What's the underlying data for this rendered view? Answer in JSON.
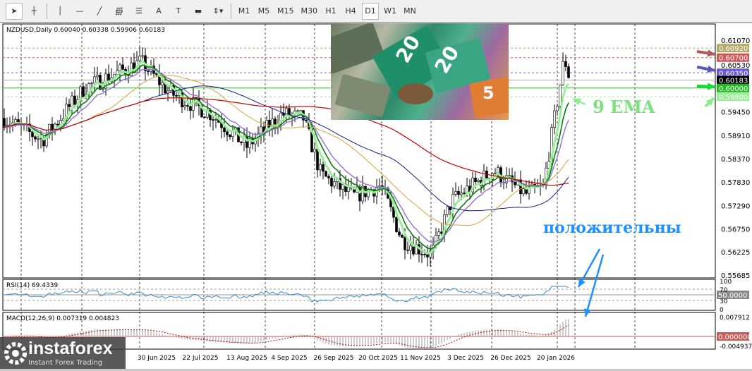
{
  "toolbar": {
    "tools": [
      "cursor",
      "crosshair",
      "vertical-line",
      "horizontal-line",
      "trendline",
      "fibonacci",
      "fibo-channel",
      "text",
      "text-label",
      "rectangle",
      "arrows"
    ],
    "text_label": "A",
    "timeframes": [
      "M1",
      "M5",
      "M15",
      "M30",
      "H1",
      "H4",
      "D1",
      "W1",
      "MN"
    ],
    "selected": "D1"
  },
  "chart": {
    "symbol_info": "NZDUSD,Daily  0.60040 0.60338 0.59906 0.60183",
    "price_ticks": [
      "0.61070",
      "0.60530",
      "0.59450",
      "0.58910",
      "0.58370",
      "0.57830",
      "0.57290",
      "0.56750",
      "0.56225",
      "0.55685"
    ],
    "price_ticks_values": [
      0.6107,
      0.6053,
      0.5945,
      0.5891,
      0.5837,
      0.5783,
      0.5729,
      0.5675,
      0.56225,
      0.55685
    ],
    "levels": [
      {
        "label": "0.60920",
        "value": 0.6092,
        "color": "#b5a96a"
      },
      {
        "label": "0.60700",
        "value": 0.607,
        "color": "#c85a5a"
      },
      {
        "label": "0.60350",
        "value": 0.6035,
        "color": "#6a5acd"
      },
      {
        "label": "0.60183",
        "value": 0.60183,
        "color": "#000000"
      },
      {
        "label": "0.60000",
        "value": 0.6,
        "color": "#22bb22"
      },
      {
        "label": "0.59800",
        "value": 0.598,
        "color": "#99ee99"
      }
    ],
    "dates": [
      "30 Jun 2025",
      "22 Jul 2025",
      "13 Aug 2025",
      "4 Sep 2025",
      "26 Sep 2025",
      "20 Oct 2025",
      "11 Nov 2025",
      "3 Dec 2025",
      "26 Dec 2025",
      "20 Jan 2026"
    ]
  },
  "rsi": {
    "label": "RSI(14) 69.4339",
    "ticks": [
      "100",
      "70",
      "30",
      "0"
    ],
    "level_label": "50.0000"
  },
  "macd": {
    "label": "MACD(12,26,9) 0.007319 0.004823",
    "ticks": [
      "0.007912",
      "-0.004937"
    ],
    "zero_label": "0.000000"
  },
  "annotations": {
    "ema": "9 EMA",
    "positive": "положительны"
  },
  "logo": {
    "name": "instaforex",
    "tagline": "Instant Forex Trading"
  }
}
